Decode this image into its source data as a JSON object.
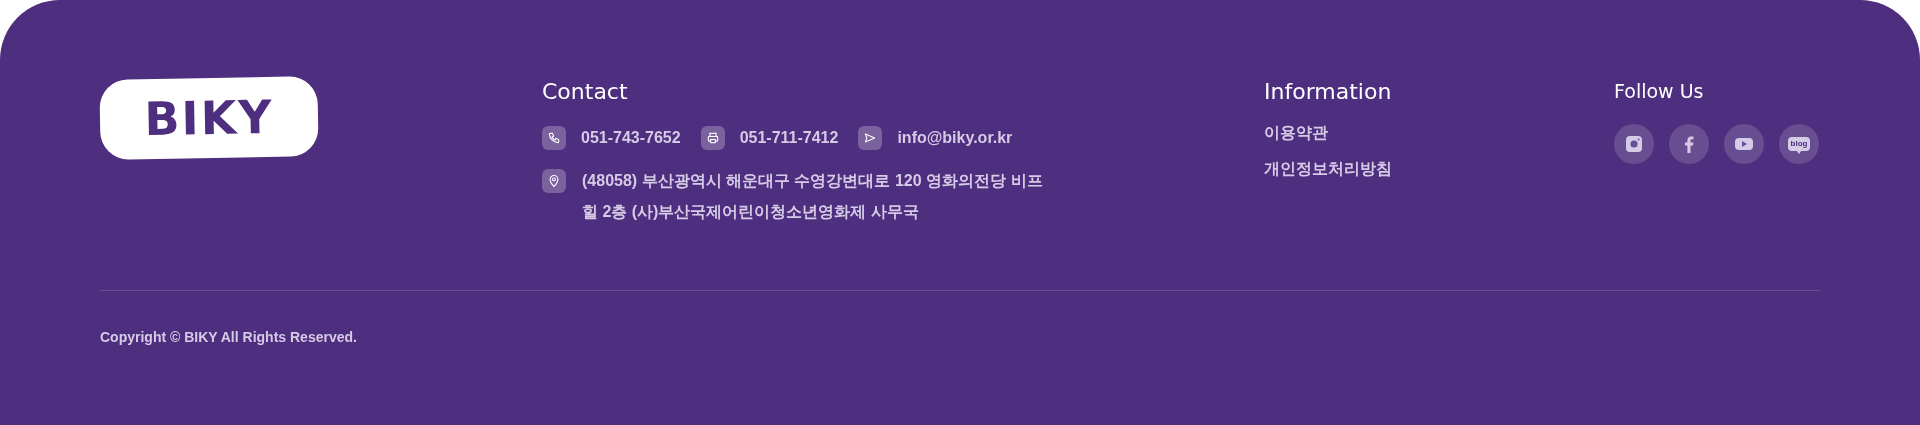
{
  "logo": {
    "text": "BIKY"
  },
  "contact": {
    "title": "Contact",
    "items": [
      {
        "kind": "phone",
        "text": "051-743-7652"
      },
      {
        "kind": "fax",
        "text": "051-711-7412"
      },
      {
        "kind": "email",
        "text": "info@biky.or.kr"
      }
    ],
    "address": {
      "kind": "address",
      "text": "(48058) 부산광역시 해운대구 수영강변대로 120 영화의전당 비프힐 2층 (사)부산국제어린이청소년영화제 사무국"
    }
  },
  "information": {
    "title": "Information",
    "links": [
      "이용약관",
      "개인정보처리방침"
    ]
  },
  "follow": {
    "title": "Follow Us",
    "socials": [
      {
        "kind": "instagram"
      },
      {
        "kind": "facebook"
      },
      {
        "kind": "youtube"
      },
      {
        "kind": "blog",
        "label": "blog"
      }
    ]
  },
  "copyright": "Copyright © BIKY All Rights Reserved."
}
